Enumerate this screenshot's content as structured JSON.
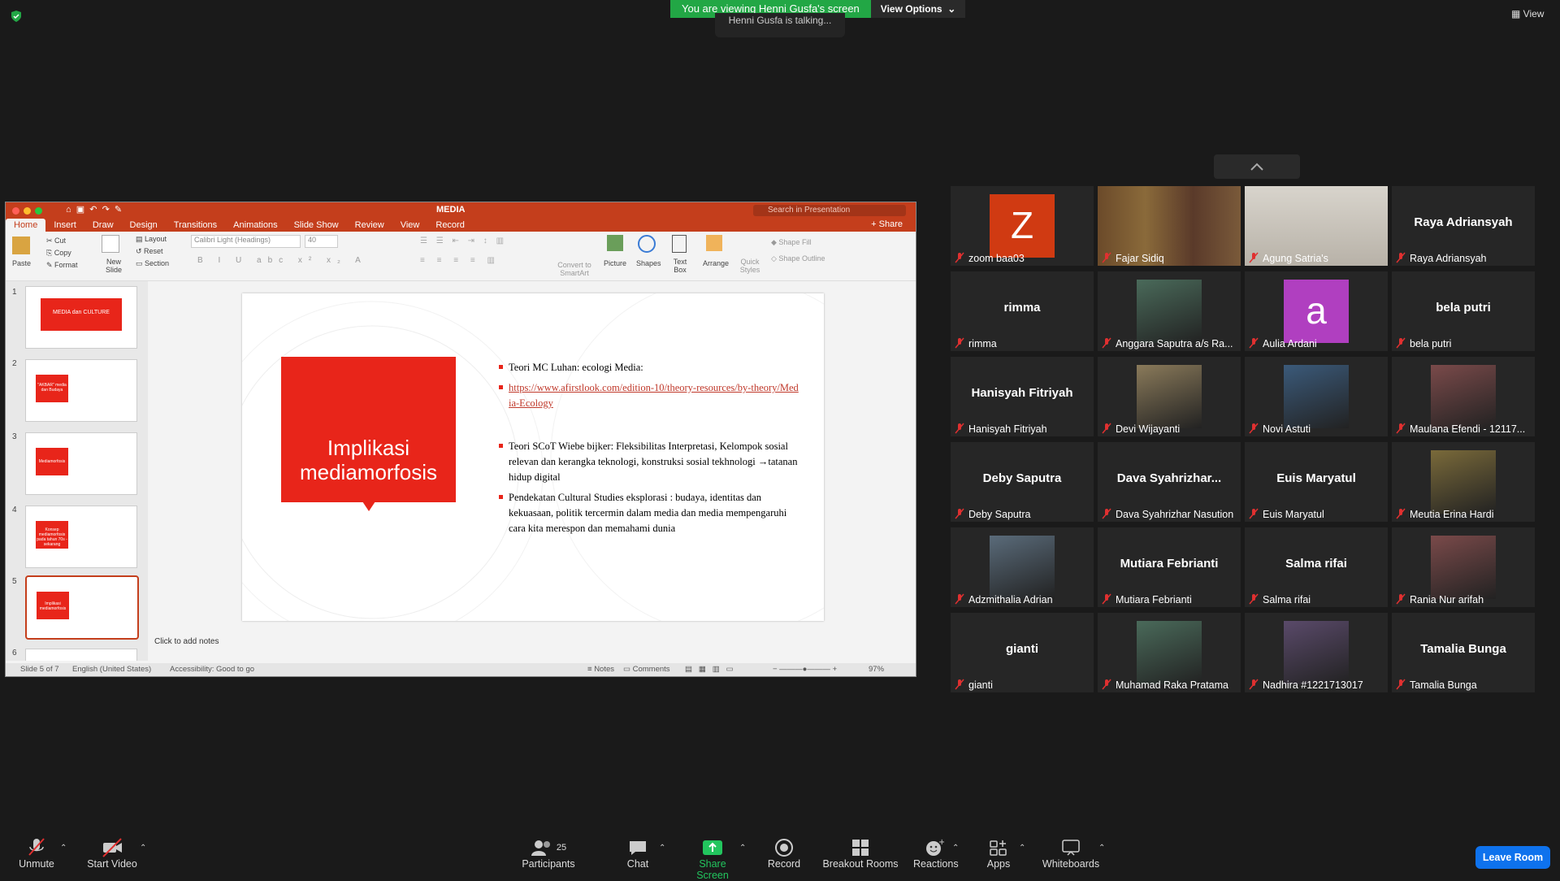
{
  "banner": {
    "viewing": "You are viewing Henni Gusfa's screen",
    "view_options": "View Options"
  },
  "talking": "Henni Gusfa is talking...",
  "view_label": "View",
  "ppt": {
    "doc_title": "MEDIA",
    "search_placeholder": "Search in Presentation",
    "tabs": [
      "Home",
      "Insert",
      "Draw",
      "Design",
      "Transitions",
      "Animations",
      "Slide Show",
      "Review",
      "View",
      "Record"
    ],
    "share": "Share",
    "ribbon": {
      "paste": "Paste",
      "cut": "Cut",
      "copy": "Copy",
      "format": "Format",
      "new_slide": "New Slide",
      "layout": "Layout",
      "reset": "Reset",
      "section": "Section",
      "font": "Calibri Light (Headings)",
      "size": "40",
      "convert": "Convert to SmartArt",
      "picture": "Picture",
      "shapes": "Shapes",
      "textbox": "Text Box",
      "arrange": "Arrange",
      "quick_styles": "Quick Styles",
      "shape_fill": "Shape Fill",
      "shape_outline": "Shape Outline"
    },
    "thumbnails": [
      {
        "num": "1",
        "title": "MEDIA dan CULTURE"
      },
      {
        "num": "2",
        "title": "\"AKBAR\" media dan Budaya"
      },
      {
        "num": "3",
        "title": "Mediamorfosis"
      },
      {
        "num": "4",
        "title": "Konsep mediamorfosis pada tahun 70s - sekarang"
      },
      {
        "num": "5",
        "title": "Implikasi mediamorfosis"
      },
      {
        "num": "6",
        "title": ""
      }
    ],
    "slide": {
      "title": "Implikasi mediamorfosis",
      "bullets": [
        "Teori MC Luhan: ecologi Media:",
        "https://www.afirstlook.com/edition-10/theory-resources/by-theory/Media-Ecology",
        "Teori SCoT Wiebe bijker: Fleksibilitas Interpretasi, Kelompok sosial relevan dan kerangka teknologi, konstruksi sosial tekhnologi →tatanan hidup digital",
        "Pendekatan Cultural Studies eksplorasi : budaya, identitas dan kekuasaan, politik tercermin dalam media dan media mempengaruhi cara kita merespon dan memahami dunia"
      ]
    },
    "notes": "Click to add notes",
    "status": {
      "slide": "Slide 5 of 7",
      "lang": "English (United States)",
      "access": "Accessibility: Good to go",
      "notes": "Notes",
      "comments": "Comments",
      "zoom": "97%"
    }
  },
  "participants": [
    {
      "label": "zoom baa03",
      "name": "",
      "kind": "letter",
      "letter": "Z",
      "color": "#d03a12"
    },
    {
      "label": "Fajar Sidiq",
      "name": "",
      "kind": "video"
    },
    {
      "label": "Agung Satria's",
      "name": "",
      "kind": "video"
    },
    {
      "label": "Raya Adriansyah",
      "name": "Raya Adriansyah",
      "kind": "name"
    },
    {
      "label": "rimma",
      "name": "rimma",
      "kind": "name"
    },
    {
      "label": "Anggara Saputra a/s Ra...",
      "name": "",
      "kind": "photo"
    },
    {
      "label": "Aulia Ardani",
      "name": "",
      "kind": "letter",
      "letter": "a",
      "color": "#b03fc0"
    },
    {
      "label": "bela putri",
      "name": "bela putri",
      "kind": "name"
    },
    {
      "label": "Hanisyah Fitriyah",
      "name": "Hanisyah Fitriyah",
      "kind": "name"
    },
    {
      "label": "Devi Wijayanti",
      "name": "",
      "kind": "photo"
    },
    {
      "label": "Novi Astuti",
      "name": "",
      "kind": "photo"
    },
    {
      "label": "Maulana Efendi - 12117...",
      "name": "",
      "kind": "photo"
    },
    {
      "label": "Deby Saputra",
      "name": "Deby Saputra",
      "kind": "name"
    },
    {
      "label": "Dava Syahrizhar Nasution",
      "name": "Dava  Syahrizhar...",
      "kind": "name"
    },
    {
      "label": "Euis Maryatul",
      "name": "Euis Maryatul",
      "kind": "name"
    },
    {
      "label": "Meutia Erina Hardi",
      "name": "",
      "kind": "photo"
    },
    {
      "label": "Adzmithalia Adrian",
      "name": "",
      "kind": "photo"
    },
    {
      "label": "Mutiara Febrianti",
      "name": "Mutiara Febrianti",
      "kind": "name"
    },
    {
      "label": "Salma rifai",
      "name": "Salma rifai",
      "kind": "name"
    },
    {
      "label": "Rania Nur arifah",
      "name": "",
      "kind": "photo"
    },
    {
      "label": "gianti",
      "name": "gianti",
      "kind": "name"
    },
    {
      "label": "Muhamad Raka Pratama",
      "name": "",
      "kind": "photo"
    },
    {
      "label": "Nadhira #1221713017",
      "name": "",
      "kind": "photo"
    },
    {
      "label": "Tamalia Bunga",
      "name": "Tamalia Bunga",
      "kind": "name"
    }
  ],
  "toolbar": {
    "unmute": "Unmute",
    "start_video": "Start Video",
    "participants": "Participants",
    "participants_count": "25",
    "chat": "Chat",
    "share": "Share Screen",
    "record": "Record",
    "breakout": "Breakout Rooms",
    "reactions": "Reactions",
    "apps": "Apps",
    "whiteboards": "Whiteboards",
    "leave": "Leave Room"
  }
}
